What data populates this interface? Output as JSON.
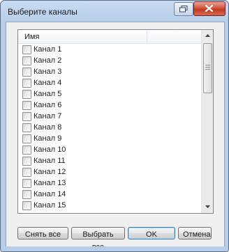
{
  "window": {
    "title": "Выберите каналы"
  },
  "list": {
    "column_header": "Имя",
    "items": [
      {
        "label": "Канал 1",
        "checked": false
      },
      {
        "label": "Канал 2",
        "checked": false
      },
      {
        "label": "Канал 3",
        "checked": false
      },
      {
        "label": "Канал 4",
        "checked": false
      },
      {
        "label": "Канал 5",
        "checked": false
      },
      {
        "label": "Канал 6",
        "checked": false
      },
      {
        "label": "Канал 7",
        "checked": false
      },
      {
        "label": "Канал 8",
        "checked": false
      },
      {
        "label": "Канал 9",
        "checked": false
      },
      {
        "label": "Канал 10",
        "checked": false
      },
      {
        "label": "Канал 11",
        "checked": false
      },
      {
        "label": "Канал 12",
        "checked": false
      },
      {
        "label": "Канал 13",
        "checked": false
      },
      {
        "label": "Канал 14",
        "checked": false
      },
      {
        "label": "Канал 15",
        "checked": false
      }
    ]
  },
  "buttons": {
    "clear_all": "Снять все",
    "select_all": "Выбрать все",
    "ok": "OK",
    "cancel": "Отмена"
  },
  "colors": {
    "title_bar": "#b7cde8",
    "close_button": "#c0391f",
    "default_button_border": "#3c7fb1"
  },
  "icons": {
    "restore": "restore-icon",
    "close": "close-icon",
    "scroll_up": "chevron-up-icon",
    "scroll_down": "chevron-down-icon"
  }
}
